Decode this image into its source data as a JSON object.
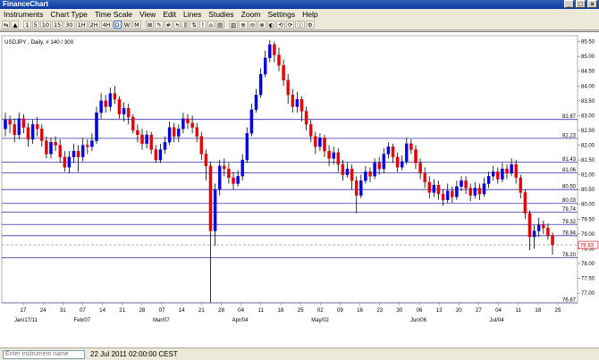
{
  "window": {
    "title": "FinanceChart",
    "controls": [
      "_",
      "□",
      "×"
    ]
  },
  "menu": [
    "Instruments",
    "Chart Type",
    "Time Scale",
    "View",
    "Edit",
    "Lines",
    "Studies",
    "Zoom",
    "Settings",
    "Help"
  ],
  "toolbar": [
    "⇆",
    "▲",
    "1",
    "5",
    "10",
    "15",
    "30",
    "1H",
    "2H",
    "4H",
    "D",
    "W",
    "M",
    "⊞",
    "✎",
    "#",
    "Ϟ",
    "⫼",
    "⇅",
    "⌇",
    "⌂",
    "▤",
    "▥",
    "⊕",
    "⊖",
    "⊗",
    "◐",
    "⟲",
    "⟳",
    "ⓘ",
    "⚙"
  ],
  "toolbar_active": "D",
  "chart": {
    "symbol_label": "USDJPY , Daily, # 140 / 300",
    "price_axis": [
      "85.50",
      "85.00",
      "84.50",
      "84.00",
      "83.50",
      "83.00",
      "82.50",
      "82.00",
      "81.50",
      "81.00",
      "80.50",
      "80.00",
      "79.50",
      "79.00",
      "78.50",
      "78.00",
      "77.50",
      "77.00"
    ],
    "date_axis": [
      "17",
      "24",
      "31",
      "07",
      "14",
      "21",
      "28",
      "07",
      "14",
      "21",
      "28",
      "04",
      "11",
      "18",
      "25",
      "02",
      "09",
      "16",
      "23",
      "30",
      "06",
      "13",
      "20",
      "27",
      "04",
      "11",
      "18",
      "25"
    ],
    "month_labels": [
      "Jan/17/11",
      "Feb/07",
      "Mar/07",
      "Apr/04",
      "May/02",
      "Jun/06",
      "Jul/04"
    ],
    "levels": [
      "82.87",
      "82.23",
      "81.43",
      "81.06",
      "80.50",
      "80.03",
      "79.74",
      "79.32",
      "78.94",
      "78.20",
      "76.67"
    ],
    "current_price": "78.63",
    "colors": {
      "up": "#0000e6",
      "down": "#e60000",
      "levels": "#3333aa",
      "current": "#c0c0c0"
    }
  },
  "chart_data": {
    "type": "candlestick",
    "symbol": "USDJPY",
    "timeframe": "Daily",
    "ylim": [
      76.67,
      85.7
    ],
    "levels": [
      82.87,
      82.23,
      81.43,
      81.06,
      80.5,
      80.03,
      79.74,
      79.32,
      78.94,
      78.2,
      76.67
    ],
    "current": 78.63,
    "candles": [
      [
        82.55,
        82.85,
        83.1,
        82.3
      ],
      [
        82.85,
        82.7,
        83.0,
        82.4
      ],
      [
        82.7,
        82.35,
        82.9,
        82.1
      ],
      [
        82.35,
        82.9,
        83.1,
        82.2
      ],
      [
        82.9,
        82.6,
        83.05,
        82.4
      ],
      [
        82.6,
        82.2,
        82.75,
        81.95
      ],
      [
        82.2,
        82.7,
        82.85,
        82.05
      ],
      [
        82.7,
        82.55,
        82.95,
        82.3
      ],
      [
        82.55,
        82.15,
        82.7,
        81.95
      ],
      [
        82.15,
        81.7,
        82.3,
        81.55
      ],
      [
        81.7,
        82.1,
        82.25,
        81.55
      ],
      [
        82.1,
        82.0,
        82.3,
        81.8
      ],
      [
        82.0,
        81.6,
        82.2,
        81.4
      ],
      [
        81.6,
        81.25,
        81.8,
        81.1
      ],
      [
        81.25,
        81.6,
        81.8,
        81.05
      ],
      [
        81.6,
        81.8,
        82.05,
        81.4
      ],
      [
        81.8,
        81.6,
        82.0,
        81.1
      ],
      [
        81.6,
        82.0,
        82.25,
        81.45
      ],
      [
        82.0,
        81.95,
        82.2,
        81.7
      ],
      [
        81.95,
        82.15,
        82.4,
        81.8
      ],
      [
        82.15,
        83.1,
        83.3,
        82.05
      ],
      [
        83.1,
        83.5,
        83.75,
        82.9
      ],
      [
        83.5,
        83.3,
        83.7,
        83.1
      ],
      [
        83.3,
        83.75,
        83.95,
        83.15
      ],
      [
        83.75,
        83.55,
        84.0,
        83.4
      ],
      [
        83.55,
        83.05,
        83.65,
        82.9
      ],
      [
        83.05,
        83.25,
        83.45,
        82.8
      ],
      [
        83.25,
        82.95,
        83.4,
        82.7
      ],
      [
        82.95,
        82.5,
        83.05,
        82.4
      ],
      [
        82.5,
        82.35,
        82.7,
        82.1
      ],
      [
        82.35,
        82.05,
        82.55,
        81.85
      ],
      [
        82.05,
        82.35,
        82.5,
        81.9
      ],
      [
        82.35,
        81.85,
        82.45,
        81.7
      ],
      [
        81.85,
        81.5,
        82.0,
        81.4
      ],
      [
        81.5,
        81.85,
        82.05,
        81.4
      ],
      [
        81.85,
        82.1,
        82.3,
        81.7
      ],
      [
        82.1,
        82.6,
        82.8,
        82.0
      ],
      [
        82.6,
        82.3,
        82.75,
        82.1
      ],
      [
        82.3,
        82.55,
        82.7,
        82.1
      ],
      [
        82.55,
        82.9,
        83.1,
        82.4
      ],
      [
        82.9,
        82.75,
        83.05,
        82.55
      ],
      [
        82.75,
        82.6,
        83.0,
        82.4
      ],
      [
        82.6,
        82.3,
        82.75,
        82.1
      ],
      [
        82.3,
        81.7,
        82.45,
        81.5
      ],
      [
        81.7,
        81.3,
        81.85,
        80.8
      ],
      [
        81.3,
        79.1,
        81.45,
        76.67
      ],
      [
        79.1,
        80.5,
        80.7,
        78.6
      ],
      [
        80.5,
        81.3,
        81.5,
        80.3
      ],
      [
        81.3,
        81.2,
        81.55,
        80.95
      ],
      [
        81.2,
        80.9,
        81.4,
        80.7
      ],
      [
        80.9,
        80.7,
        81.1,
        80.5
      ],
      [
        80.7,
        80.95,
        81.15,
        80.6
      ],
      [
        80.95,
        81.5,
        81.7,
        80.8
      ],
      [
        81.5,
        82.4,
        82.6,
        81.4
      ],
      [
        82.4,
        83.2,
        83.4,
        82.3
      ],
      [
        83.2,
        83.7,
        83.9,
        83.1
      ],
      [
        83.7,
        84.4,
        84.6,
        83.6
      ],
      [
        84.4,
        84.95,
        85.2,
        84.3
      ],
      [
        84.95,
        85.4,
        85.55,
        84.8
      ],
      [
        85.4,
        85.05,
        85.5,
        84.8
      ],
      [
        85.05,
        84.7,
        85.3,
        84.5
      ],
      [
        84.7,
        84.2,
        84.9,
        84.0
      ],
      [
        84.2,
        83.7,
        84.4,
        83.4
      ],
      [
        83.7,
        83.3,
        83.9,
        83.1
      ],
      [
        83.3,
        83.55,
        83.8,
        83.1
      ],
      [
        83.55,
        83.15,
        83.65,
        82.8
      ],
      [
        83.15,
        82.7,
        83.3,
        82.5
      ],
      [
        82.7,
        82.3,
        82.85,
        82.1
      ],
      [
        82.3,
        81.95,
        82.45,
        81.7
      ],
      [
        81.95,
        82.25,
        82.4,
        81.8
      ],
      [
        82.25,
        81.8,
        82.35,
        81.6
      ],
      [
        81.8,
        81.55,
        82.0,
        81.3
      ],
      [
        81.55,
        81.75,
        81.95,
        81.35
      ],
      [
        81.75,
        81.35,
        81.9,
        81.1
      ],
      [
        81.35,
        81.0,
        81.5,
        80.8
      ],
      [
        81.0,
        81.2,
        81.4,
        80.9
      ],
      [
        81.2,
        80.8,
        81.35,
        80.5
      ],
      [
        80.8,
        80.3,
        80.95,
        79.7
      ],
      [
        80.3,
        80.8,
        81.0,
        80.2
      ],
      [
        80.8,
        81.1,
        81.3,
        80.7
      ],
      [
        81.1,
        80.95,
        81.25,
        80.75
      ],
      [
        80.95,
        81.4,
        81.55,
        80.85
      ],
      [
        81.4,
        81.2,
        81.6,
        81.0
      ],
      [
        81.2,
        81.7,
        81.9,
        81.05
      ],
      [
        81.7,
        81.95,
        82.1,
        81.55
      ],
      [
        81.95,
        81.6,
        82.05,
        81.4
      ],
      [
        81.6,
        81.25,
        81.75,
        81.1
      ],
      [
        81.25,
        81.45,
        81.65,
        81.15
      ],
      [
        81.45,
        82.05,
        82.25,
        81.35
      ],
      [
        82.05,
        81.85,
        82.2,
        81.7
      ],
      [
        81.85,
        81.4,
        82.0,
        81.2
      ],
      [
        81.4,
        81.05,
        81.55,
        80.85
      ],
      [
        81.05,
        80.75,
        81.25,
        80.55
      ],
      [
        80.75,
        80.4,
        80.95,
        80.2
      ],
      [
        80.4,
        80.65,
        80.85,
        80.25
      ],
      [
        80.65,
        80.35,
        80.8,
        80.15
      ],
      [
        80.35,
        80.15,
        80.5,
        79.95
      ],
      [
        80.15,
        80.45,
        80.7,
        80.05
      ],
      [
        80.45,
        80.25,
        80.6,
        80.05
      ],
      [
        80.25,
        80.6,
        80.8,
        80.15
      ],
      [
        80.6,
        80.8,
        80.95,
        80.45
      ],
      [
        80.8,
        80.55,
        80.95,
        80.35
      ],
      [
        80.55,
        80.3,
        80.7,
        80.1
      ],
      [
        80.3,
        80.55,
        80.75,
        80.2
      ],
      [
        80.55,
        80.35,
        80.7,
        80.15
      ],
      [
        80.35,
        80.7,
        80.9,
        80.25
      ],
      [
        80.7,
        80.95,
        81.1,
        80.55
      ],
      [
        80.95,
        81.1,
        81.3,
        80.8
      ],
      [
        81.1,
        80.85,
        81.25,
        80.7
      ],
      [
        80.85,
        81.2,
        81.4,
        80.75
      ],
      [
        81.2,
        81.05,
        81.35,
        80.85
      ],
      [
        81.05,
        81.35,
        81.55,
        80.95
      ],
      [
        81.35,
        80.9,
        81.5,
        80.7
      ],
      [
        80.9,
        80.4,
        81.0,
        80.2
      ],
      [
        80.4,
        79.7,
        80.5,
        79.5
      ],
      [
        79.7,
        78.9,
        79.8,
        78.45
      ],
      [
        78.9,
        79.1,
        79.3,
        78.5
      ],
      [
        79.1,
        79.3,
        79.55,
        78.9
      ],
      [
        79.3,
        79.2,
        79.45,
        79.0
      ],
      [
        79.2,
        78.95,
        79.35,
        78.8
      ],
      [
        78.95,
        78.63,
        79.05,
        78.3
      ]
    ]
  },
  "status": {
    "search_placeholder": "Enter instrument name",
    "datetime": "22 Jul 2011 02:00:00 CEST"
  }
}
